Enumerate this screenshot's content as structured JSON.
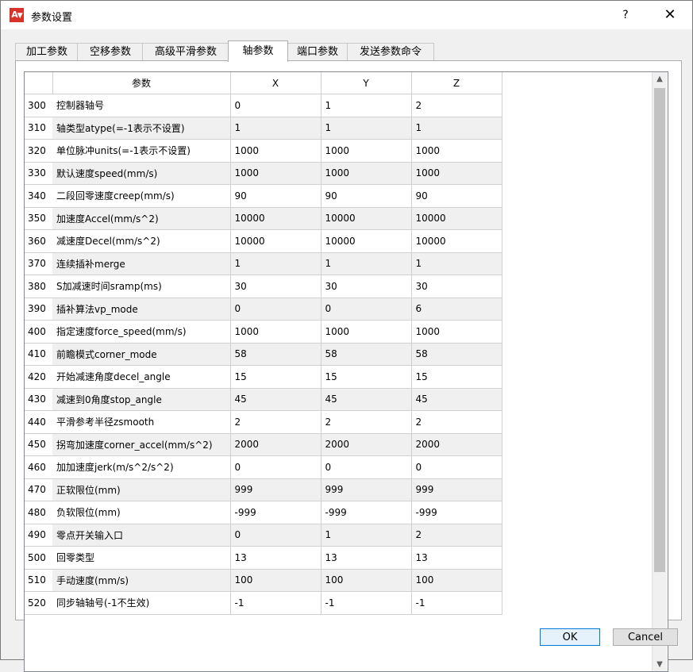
{
  "window": {
    "title": "参数设置",
    "icon_text": "A",
    "help_label": "?",
    "close_label": "✕"
  },
  "tabs": [
    {
      "label": "加工参数"
    },
    {
      "label": "空移参数"
    },
    {
      "label": "高级平滑参数"
    },
    {
      "label": "轴参数"
    },
    {
      "label": "端口参数"
    },
    {
      "label": "发送参数命令"
    }
  ],
  "active_tab": "轴参数",
  "table": {
    "headers": [
      "",
      "参数",
      "X",
      "Y",
      "Z"
    ],
    "rows": [
      {
        "num": "300",
        "name": "控制器轴号",
        "x": "0",
        "y": "1",
        "z": "2"
      },
      {
        "num": "310",
        "name": "轴类型atype(=-1表示不设置)",
        "x": "1",
        "y": "1",
        "z": "1"
      },
      {
        "num": "320",
        "name": "单位脉冲units(=-1表示不设置)",
        "x": "1000",
        "y": "1000",
        "z": "1000"
      },
      {
        "num": "330",
        "name": "默认速度speed(mm/s)",
        "x": "1000",
        "y": "1000",
        "z": "1000"
      },
      {
        "num": "340",
        "name": "二段回零速度creep(mm/s)",
        "x": "90",
        "y": "90",
        "z": "90"
      },
      {
        "num": "350",
        "name": "加速度Accel(mm/s^2)",
        "x": "10000",
        "y": "10000",
        "z": "10000"
      },
      {
        "num": "360",
        "name": "减速度Decel(mm/s^2)",
        "x": "10000",
        "y": "10000",
        "z": "10000"
      },
      {
        "num": "370",
        "name": "连续插补merge",
        "x": "1",
        "y": "1",
        "z": "1"
      },
      {
        "num": "380",
        "name": "S加减速时间sramp(ms)",
        "x": "30",
        "y": "30",
        "z": "30"
      },
      {
        "num": "390",
        "name": "插补算法vp_mode",
        "x": "0",
        "y": "0",
        "z": "6"
      },
      {
        "num": "400",
        "name": "指定速度force_speed(mm/s)",
        "x": "1000",
        "y": "1000",
        "z": "1000"
      },
      {
        "num": "410",
        "name": "前瞻模式corner_mode",
        "x": "58",
        "y": "58",
        "z": "58"
      },
      {
        "num": "420",
        "name": "开始减速角度decel_angle",
        "x": "15",
        "y": "15",
        "z": "15"
      },
      {
        "num": "430",
        "name": "减速到0角度stop_angle",
        "x": "45",
        "y": "45",
        "z": "45"
      },
      {
        "num": "440",
        "name": "平滑参考半径zsmooth",
        "x": "2",
        "y": "2",
        "z": "2"
      },
      {
        "num": "450",
        "name": "拐弯加速度corner_accel(mm/s^2)",
        "x": "2000",
        "y": "2000",
        "z": "2000"
      },
      {
        "num": "460",
        "name": "加加速度jerk(m/s^2/s^2)",
        "x": "0",
        "y": "0",
        "z": "0"
      },
      {
        "num": "470",
        "name": "正软限位(mm)",
        "x": "999",
        "y": "999",
        "z": "999"
      },
      {
        "num": "480",
        "name": "负软限位(mm)",
        "x": "-999",
        "y": "-999",
        "z": "-999"
      },
      {
        "num": "490",
        "name": "零点开关输入口",
        "x": "0",
        "y": "1",
        "z": "2"
      },
      {
        "num": "500",
        "name": "回零类型",
        "x": "13",
        "y": "13",
        "z": "13"
      },
      {
        "num": "510",
        "name": "手动速度(mm/s)",
        "x": "100",
        "y": "100",
        "z": "100"
      },
      {
        "num": "520",
        "name": "同步轴轴号(-1不生效)",
        "x": "-1",
        "y": "-1",
        "z": "-1"
      }
    ]
  },
  "buttons": {
    "ok": "OK",
    "cancel": "Cancel"
  },
  "colors": {
    "icon_bg": "#d6332b",
    "ok_border": "#0078d7",
    "row_alt": "#f0f0f0"
  }
}
